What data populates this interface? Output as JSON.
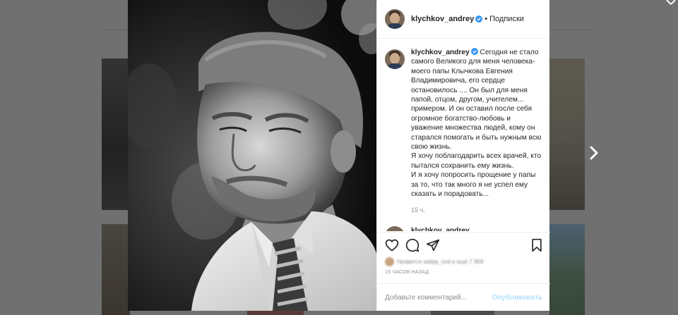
{
  "post": {
    "username": "klychkov_andrey",
    "follow_state": "Подписки",
    "separator": "•",
    "caption_lines": [
      "Сегодня не стало самого Великого для меня человека-моего папы Клычкова Евгения Владимировича, его сердце остановилось .... Он был для меня папой, отцом, другом, учителем... примером. И он оставил после себя огромное богатство-любовь и уважение множества людей, кому он старался помогать и быть нужным всю свою жизнь.",
      "Я хочу поблагодарить всех врачей, кто пытался сохранить ему жизнь.",
      "И я хочу попросить прощение у папы за то, что так много я не успел ему сказать и порадовать..."
    ],
    "time_short": "15 ч.",
    "comment_preview": "klychkov_andrey",
    "likes_text": "Нравится sabija_ovd и ещё 7 958",
    "time_full": "15 ЧАСОВ НАЗАД",
    "comment_placeholder": "Добавьте комментарий...",
    "publish_label": "Опубликовать"
  },
  "icons": {
    "like": "heart-icon",
    "comment": "comment-icon",
    "share": "paper-plane-icon",
    "save": "bookmark-icon",
    "verified": "verified-badge-icon",
    "next": "chevron-right-icon",
    "close": "close-icon"
  },
  "colors": {
    "verified": "#3897f0",
    "text": "#262626",
    "muted": "#8e8e8e",
    "publish_disabled": "#b2dffc",
    "overlay": "#707070"
  }
}
